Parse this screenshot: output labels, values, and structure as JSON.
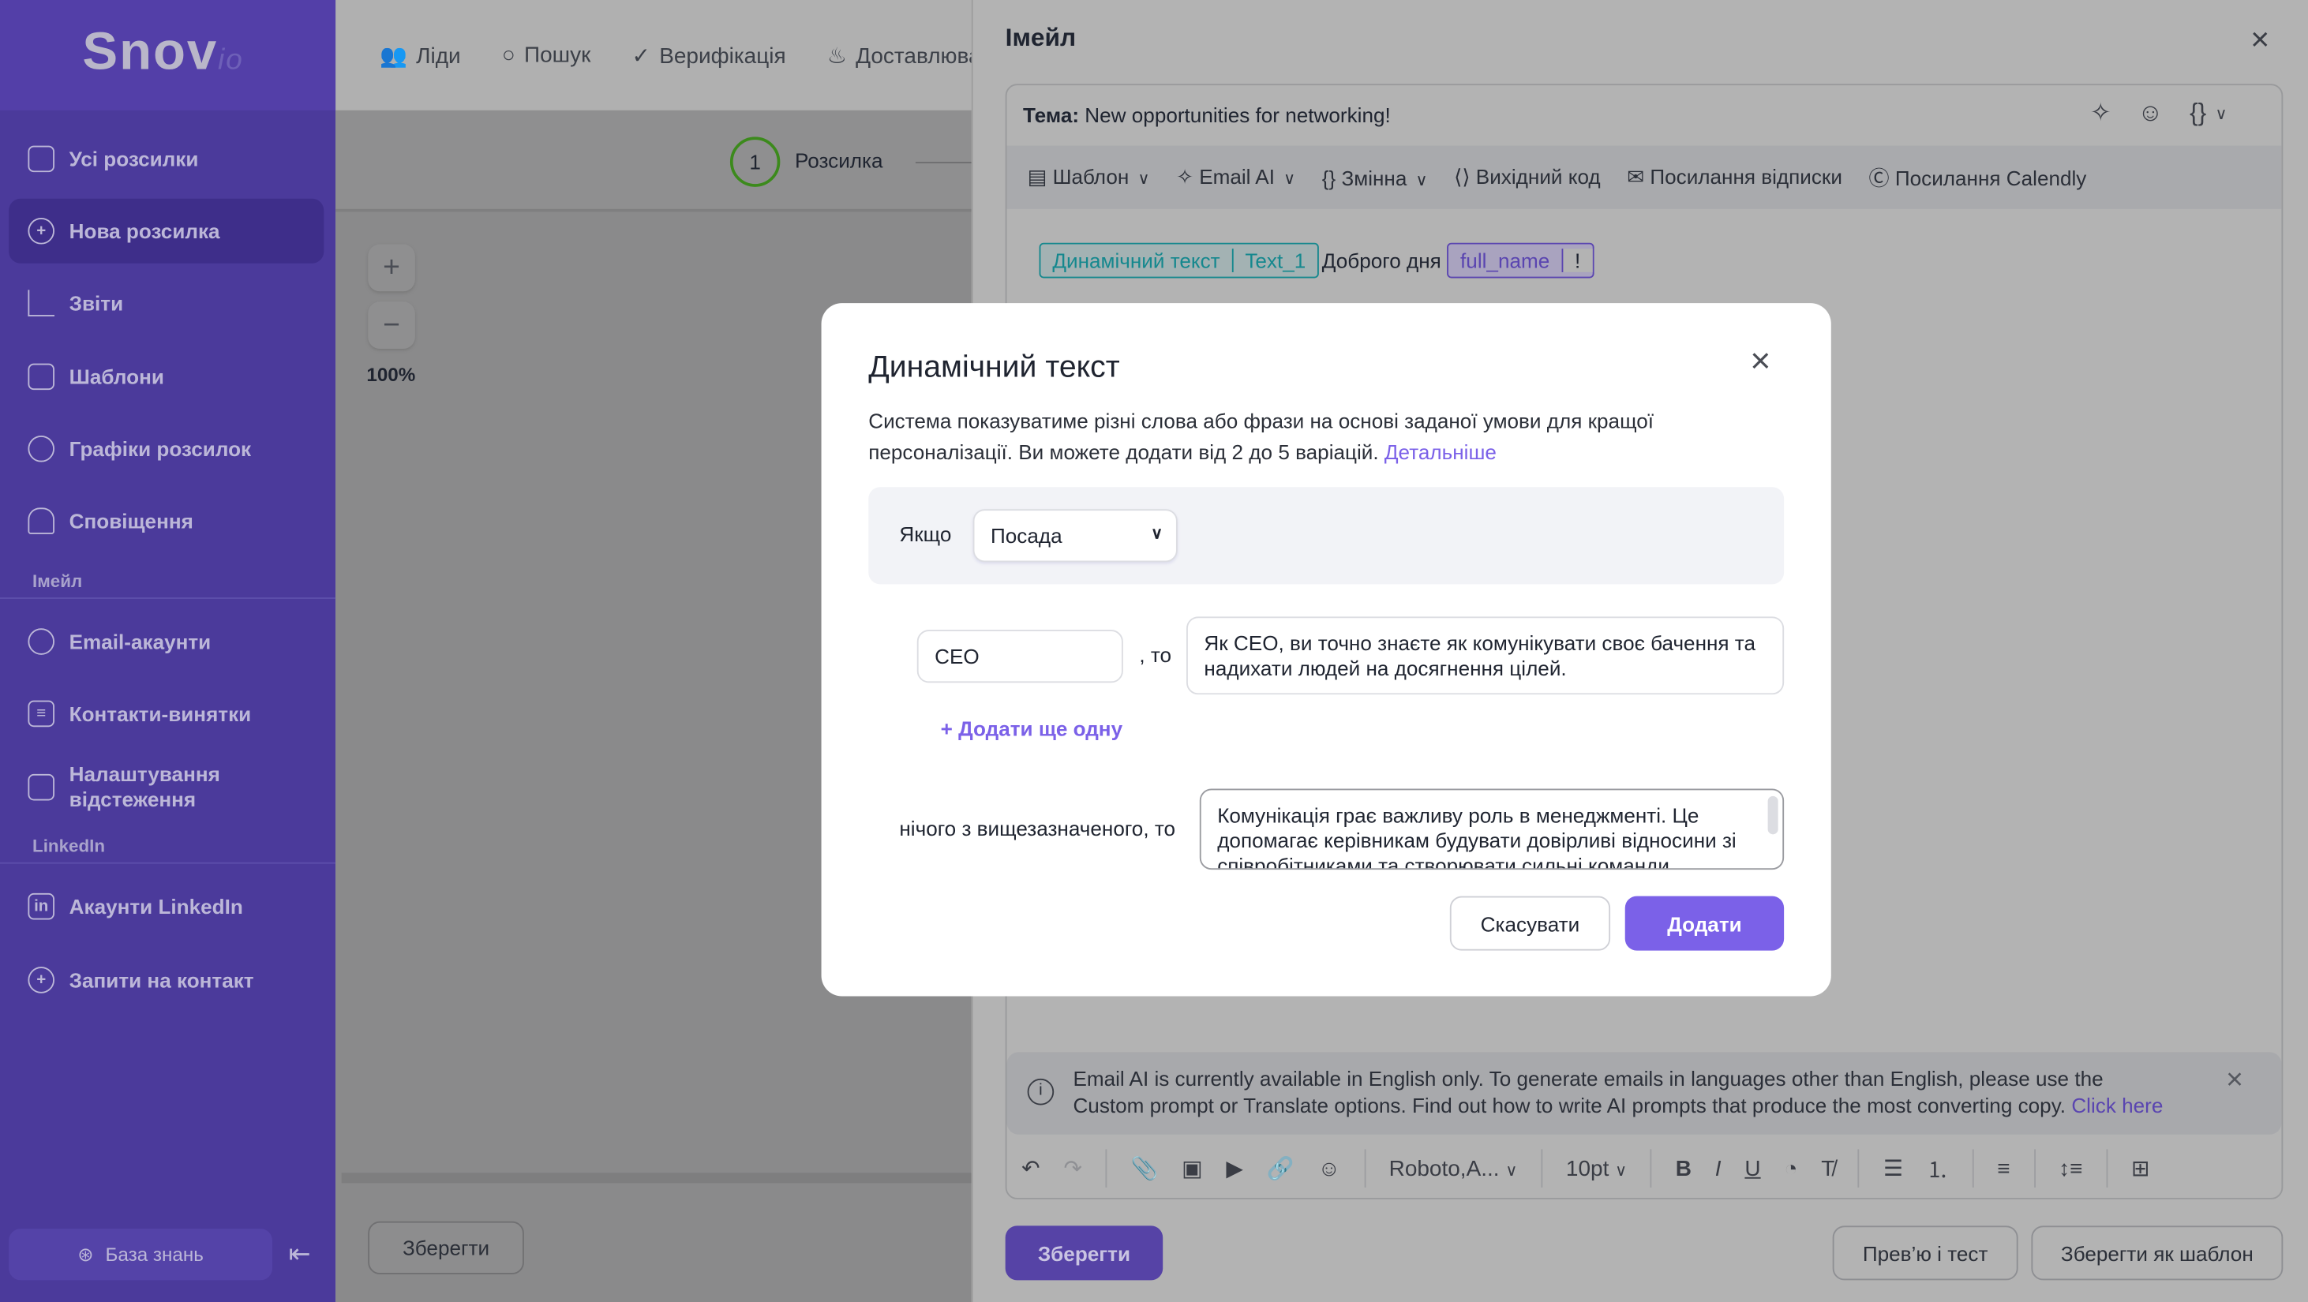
{
  "sidebar": {
    "logo": "Snov",
    "logo_suffix": "io",
    "items": [
      {
        "label": "Усі розсилки",
        "icon": "mail-icon"
      },
      {
        "label": "Нова розсилка",
        "icon": "plus-circle-icon",
        "active": true
      },
      {
        "label": "Звіти",
        "icon": "chart-icon"
      },
      {
        "label": "Шаблони",
        "icon": "template-icon"
      },
      {
        "label": "Графіки розсилок",
        "icon": "clock-icon"
      },
      {
        "label": "Сповіщення",
        "icon": "bell-icon"
      }
    ],
    "section_email": "Імейл",
    "email_items": [
      {
        "label": "Email-акаунти",
        "icon": "account-icon"
      },
      {
        "label": "Контакти-винятки",
        "icon": "list-icon"
      },
      {
        "label": "Налаштування відстеження",
        "icon": "tracking-icon"
      }
    ],
    "section_linkedin": "LinkedIn",
    "linkedin_items": [
      {
        "label": "Акаунти LinkedIn",
        "icon": "linkedin-icon"
      },
      {
        "label": "Запити на контакт",
        "icon": "add-user-icon"
      }
    ],
    "knowledge_base": "База знань"
  },
  "topnav": [
    {
      "label": "Ліди",
      "icon": "users-icon"
    },
    {
      "label": "Пошук",
      "icon": "search-icon"
    },
    {
      "label": "Верифікація",
      "icon": "check-circle-icon"
    },
    {
      "label": "Доставлюваність",
      "icon": "flame-icon"
    }
  ],
  "main": {
    "step_number": "1",
    "step_label": "Розсилка",
    "zoom": "100%",
    "save": "Зберегти"
  },
  "email_panel": {
    "title": "Імейл",
    "subject_label": "Тема:",
    "subject": "New opportunities for networking!",
    "toolbar": [
      "Шаблон",
      "Email AI",
      "Змінна",
      "Вихідний код",
      "Посилання відписки",
      "Посилання Calendly"
    ],
    "body": {
      "chip1_label": "Динамічний текст",
      "chip1_value": "Text_1",
      "text": "Доброго дня",
      "chip2": "full_name",
      "chip2_suffix": "!"
    },
    "info": "Email AI is currently available in English only. To generate emails in languages other than English, please use the Custom prompt or Translate options. Find out how to write AI prompts that produce the most converting copy.",
    "info_link": "Click here",
    "font": "Roboto,A...",
    "font_size": "10pt",
    "save": "Зберегти",
    "preview": "Прев’ю і тест",
    "save_template": "Зберегти як шаблон"
  },
  "modal": {
    "title": "Динамічний текст",
    "description": "Система показуватиме різні слова або фрази на основі заданої умови для кращої персоналізації. Ви можете додати від 2 до 5 варіацій.",
    "more_link": "Детальніше",
    "if_label": "Якщо",
    "condition": "Посада",
    "value": "CEO",
    "then": ", то",
    "then_text": "Як CEO, ви точно знаєте як комунікувати своє бачення та надихати людей на досягнення цілей.",
    "add_more": "Додати ще одну",
    "else_label": "нічого з вищезазначеного, то",
    "else_text": "Комунікація грає важливу роль в менеджменті. Це допомагає керівникам будувати довірливі відносини зі співробітниками та створювати сильні команди.",
    "cancel": "Скасувати",
    "add": "Додати"
  },
  "colors": {
    "accent": "#7b61e8",
    "teal": "#15888e",
    "sidebar": "#4b3a9b"
  }
}
